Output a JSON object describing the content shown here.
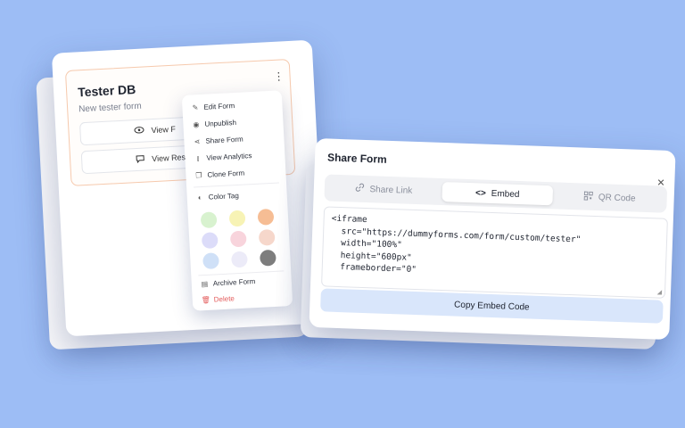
{
  "form_card": {
    "title": "Tester DB",
    "subtitle": "New tester form",
    "view_button": "View F",
    "view_responses_button": "View Res"
  },
  "menu": {
    "items": [
      {
        "label": "Edit Form",
        "icon": "edit-icon"
      },
      {
        "label": "Unpublish",
        "icon": "eye-icon"
      },
      {
        "label": "Share Form",
        "icon": "share-icon"
      },
      {
        "label": "View Analytics",
        "icon": "analytics-icon"
      },
      {
        "label": "Clone Form",
        "icon": "copy-icon"
      }
    ],
    "color_tag_label": "Color Tag",
    "swatches": [
      "#d8f2cf",
      "#f7f3b5",
      "#f6bd94",
      "#dcdcf9",
      "#f8d4dc",
      "#f6d7cb",
      "#cfe0f7",
      "#ecebf8",
      "#7d7d7d"
    ],
    "archive_label": "Archive Form",
    "delete_label": "Delete"
  },
  "share_modal": {
    "title": "Share Form",
    "tabs": [
      {
        "label": "Share Link",
        "icon": "link-icon",
        "active": false
      },
      {
        "label": "Embed",
        "icon": "code-icon",
        "active": true
      },
      {
        "label": "QR Code",
        "icon": "qr-code-icon",
        "active": false
      }
    ],
    "embed_code": "<iframe\n  src=\"https://dummyforms.com/form/custom/tester\"\n  width=\"100%\"\n  height=\"600px\"\n  frameborder=\"0\"",
    "copy_button": "Copy Embed Code"
  },
  "colors": {
    "background": "#9dbdf5",
    "card_border": "#f6c9ad",
    "copy_button": "#d9e6fb",
    "delete": "#e35a5a"
  }
}
